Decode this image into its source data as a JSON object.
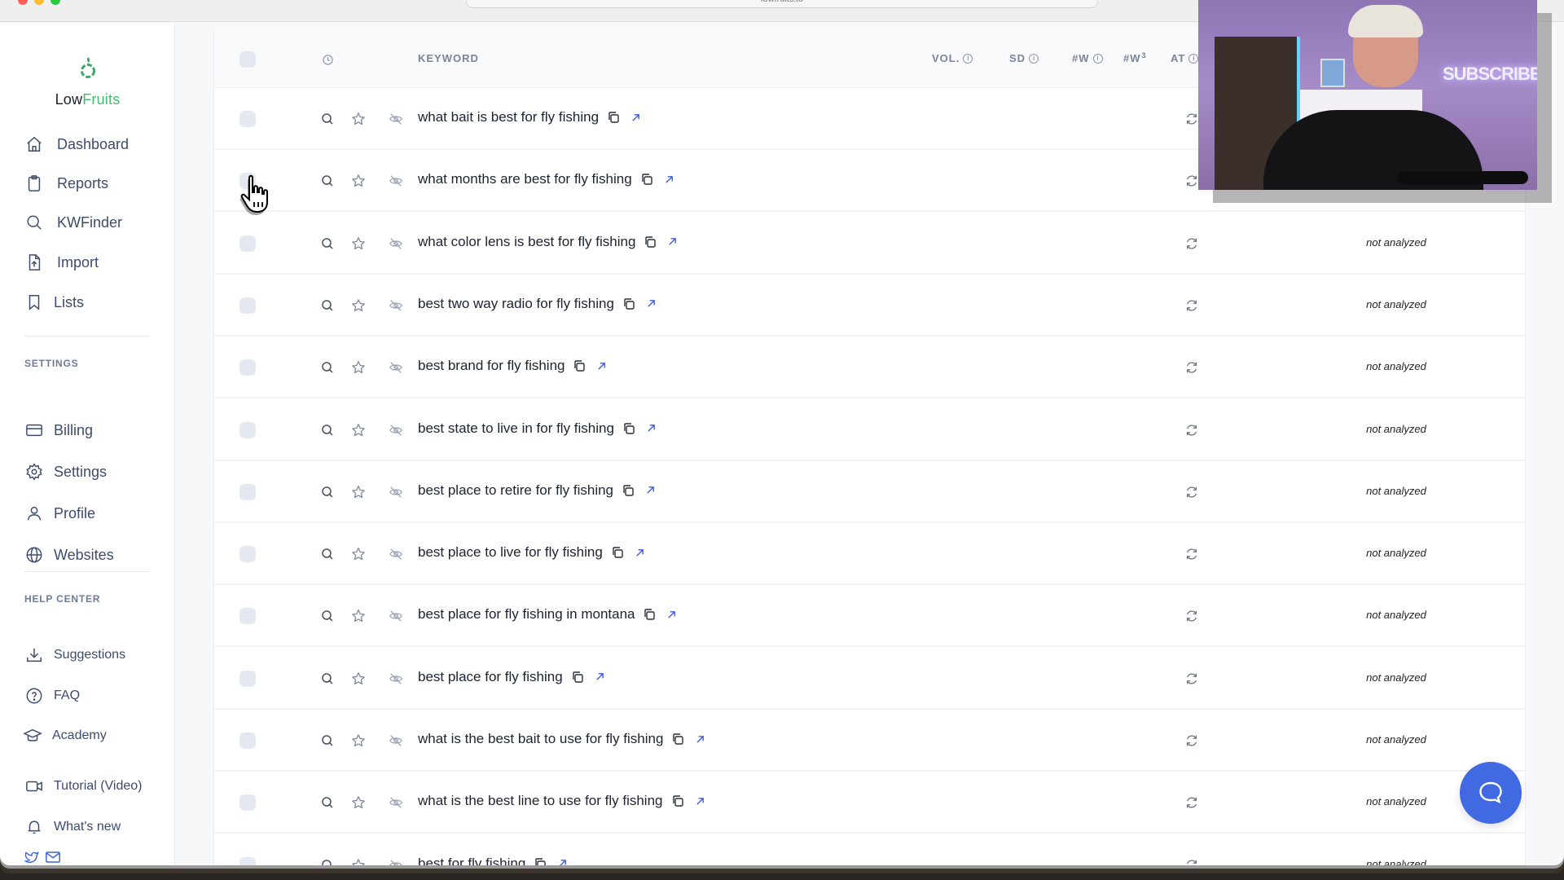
{
  "browser": {
    "url_text": "lowfruits.io"
  },
  "brand": {
    "name_part1": "Low",
    "name_part2": "Fruits",
    "accent": "#3fbd6c"
  },
  "sidebar": {
    "main_items": [
      {
        "label": "Dashboard",
        "icon": "home-icon"
      },
      {
        "label": "Reports",
        "icon": "clipboard-icon"
      },
      {
        "label": "KWFinder",
        "icon": "search-icon"
      },
      {
        "label": "Import",
        "icon": "file-import-icon"
      },
      {
        "label": "Lists",
        "icon": "bookmark-icon"
      }
    ],
    "settings_label": "SETTINGS",
    "settings_items": [
      {
        "label": "Billing",
        "icon": "credit-card-icon"
      },
      {
        "label": "Settings",
        "icon": "gear-icon"
      },
      {
        "label": "Profile",
        "icon": "user-icon"
      },
      {
        "label": "Websites",
        "icon": "globe-icon"
      }
    ],
    "help_label": "HELP CENTER",
    "help_items": [
      {
        "label": "Suggestions",
        "icon": "download-icon"
      },
      {
        "label": "FAQ",
        "icon": "question-circle-icon"
      },
      {
        "label": "Academy",
        "icon": "graduation-cap-icon"
      },
      {
        "label": "Tutorial (Video)",
        "icon": "video-camera-icon"
      },
      {
        "label": "What's new",
        "icon": "bell-icon"
      }
    ]
  },
  "table": {
    "headers": {
      "keyword": "KEYWORD",
      "vol": "VOL.",
      "sd": "SD",
      "w": "#W",
      "w3": "#W",
      "w3_sup": "3",
      "at": "AT",
      "info_glyph": "i"
    },
    "rows": [
      {
        "keyword": "what bait is best for fly fishing",
        "status": ""
      },
      {
        "keyword": "what months are best for fly fishing",
        "status": ""
      },
      {
        "keyword": "what color lens is best for fly fishing",
        "status": "not analyzed"
      },
      {
        "keyword": "best two way radio for fly fishing",
        "status": "not analyzed"
      },
      {
        "keyword": "best brand for fly fishing",
        "status": "not analyzed"
      },
      {
        "keyword": "best state to live in for fly fishing",
        "status": "not analyzed"
      },
      {
        "keyword": "best place to retire for fly fishing",
        "status": "not analyzed"
      },
      {
        "keyword": "best place to live for fly fishing",
        "status": "not analyzed"
      },
      {
        "keyword": "best place for fly fishing in montana",
        "status": "not analyzed"
      },
      {
        "keyword": "best place for fly fishing",
        "status": "not analyzed"
      },
      {
        "keyword": "what is the best bait to use for fly fishing",
        "status": "not analyzed"
      },
      {
        "keyword": "what is the best line to use for fly fishing",
        "status": "not analyzed"
      },
      {
        "keyword": "best for fly fishing",
        "status": "not analyzed"
      }
    ]
  },
  "overlay": {
    "webcam_sign_text": "SUBSCRIBE"
  },
  "colors": {
    "chat_button": "#4169e1",
    "link_arrow": "#3b5bdb",
    "nav_text": "#3d4b6d"
  }
}
